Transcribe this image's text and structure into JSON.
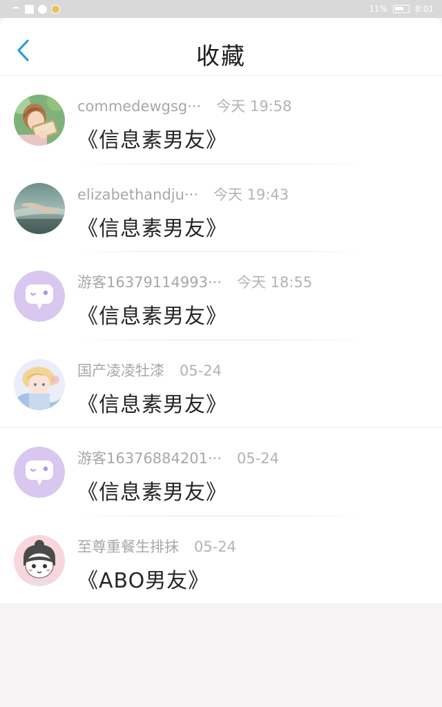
{
  "status_bar": {
    "battery": "11%",
    "time": "8:01"
  },
  "header": {
    "title": "收藏",
    "back_icon": "chevron-left-icon"
  },
  "colors": {
    "accent": "#2a9be8",
    "bot_avatar_bg": "#d9c7f0",
    "bot_bubble": "#ffffff",
    "bot_eye": "#b493e3"
  },
  "favorites": [
    {
      "name": "commedewgsg···",
      "time": "今天 19:58",
      "message": "《信息素男友》",
      "avatar": "girl-reading-photo"
    },
    {
      "name": "elizabethandju···",
      "time": "今天 19:43",
      "message": "《信息素男友》",
      "avatar": "hand-in-rain-photo"
    },
    {
      "name": "游客16379114993···",
      "time": "今天 18:55",
      "message": "《信息素男友》",
      "avatar": "default-chat-bot-avatar"
    },
    {
      "name": "国产凌凌牡漆",
      "time": "05-24",
      "message": "《信息素男友》",
      "avatar": "anime-boy-illustration"
    },
    {
      "name": "游客16376884201···",
      "time": "05-24",
      "message": "《信息素男友》",
      "avatar": "default-chat-bot-avatar"
    },
    {
      "name": "至尊重餐生排抹",
      "time": "05-24",
      "message": "《ABO男友》",
      "avatar": "cartoon-girl-illustration"
    }
  ]
}
